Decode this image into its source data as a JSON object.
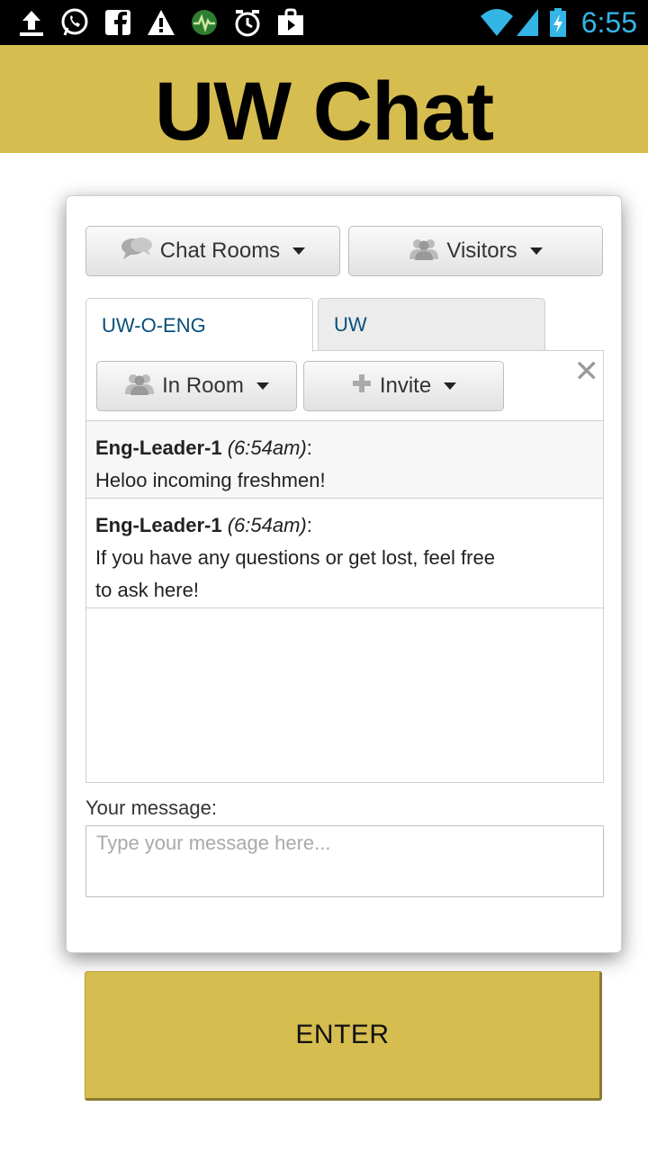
{
  "status_bar": {
    "time": "6:55",
    "left_icons": [
      "upload-icon",
      "whatsapp-icon",
      "facebook-icon",
      "warning-icon",
      "monitor-icon",
      "alarm-icon",
      "shop-bag-icon"
    ],
    "right_icons": [
      "wifi-icon",
      "signal-icon",
      "battery-charging-icon"
    ]
  },
  "header": {
    "title": "UW Chat"
  },
  "toolbar": {
    "chat_rooms_label": "Chat Rooms",
    "visitors_label": "Visitors"
  },
  "tabs": [
    {
      "label": "UW-O-ENG",
      "active": true
    },
    {
      "label": "UW",
      "active": false
    }
  ],
  "room_toolbar": {
    "in_room_label": "In Room",
    "invite_label": "Invite"
  },
  "messages": [
    {
      "author": "Eng-Leader-1",
      "time": "(6:54am)",
      "sep": ":",
      "text": "Heloo incoming freshmen!"
    },
    {
      "author": "Eng-Leader-1",
      "time": "(6:54am)",
      "sep": ":",
      "text": "If you have any questions or get lost, feel free to ask here!"
    }
  ],
  "composer": {
    "label": "Your message:",
    "placeholder": "Type your message here...",
    "value": ""
  },
  "enter_button": {
    "label": "ENTER"
  },
  "colors": {
    "accent": "#d6bd4f",
    "status_time": "#33b5e5",
    "tab_text": "#0a4f7a"
  }
}
